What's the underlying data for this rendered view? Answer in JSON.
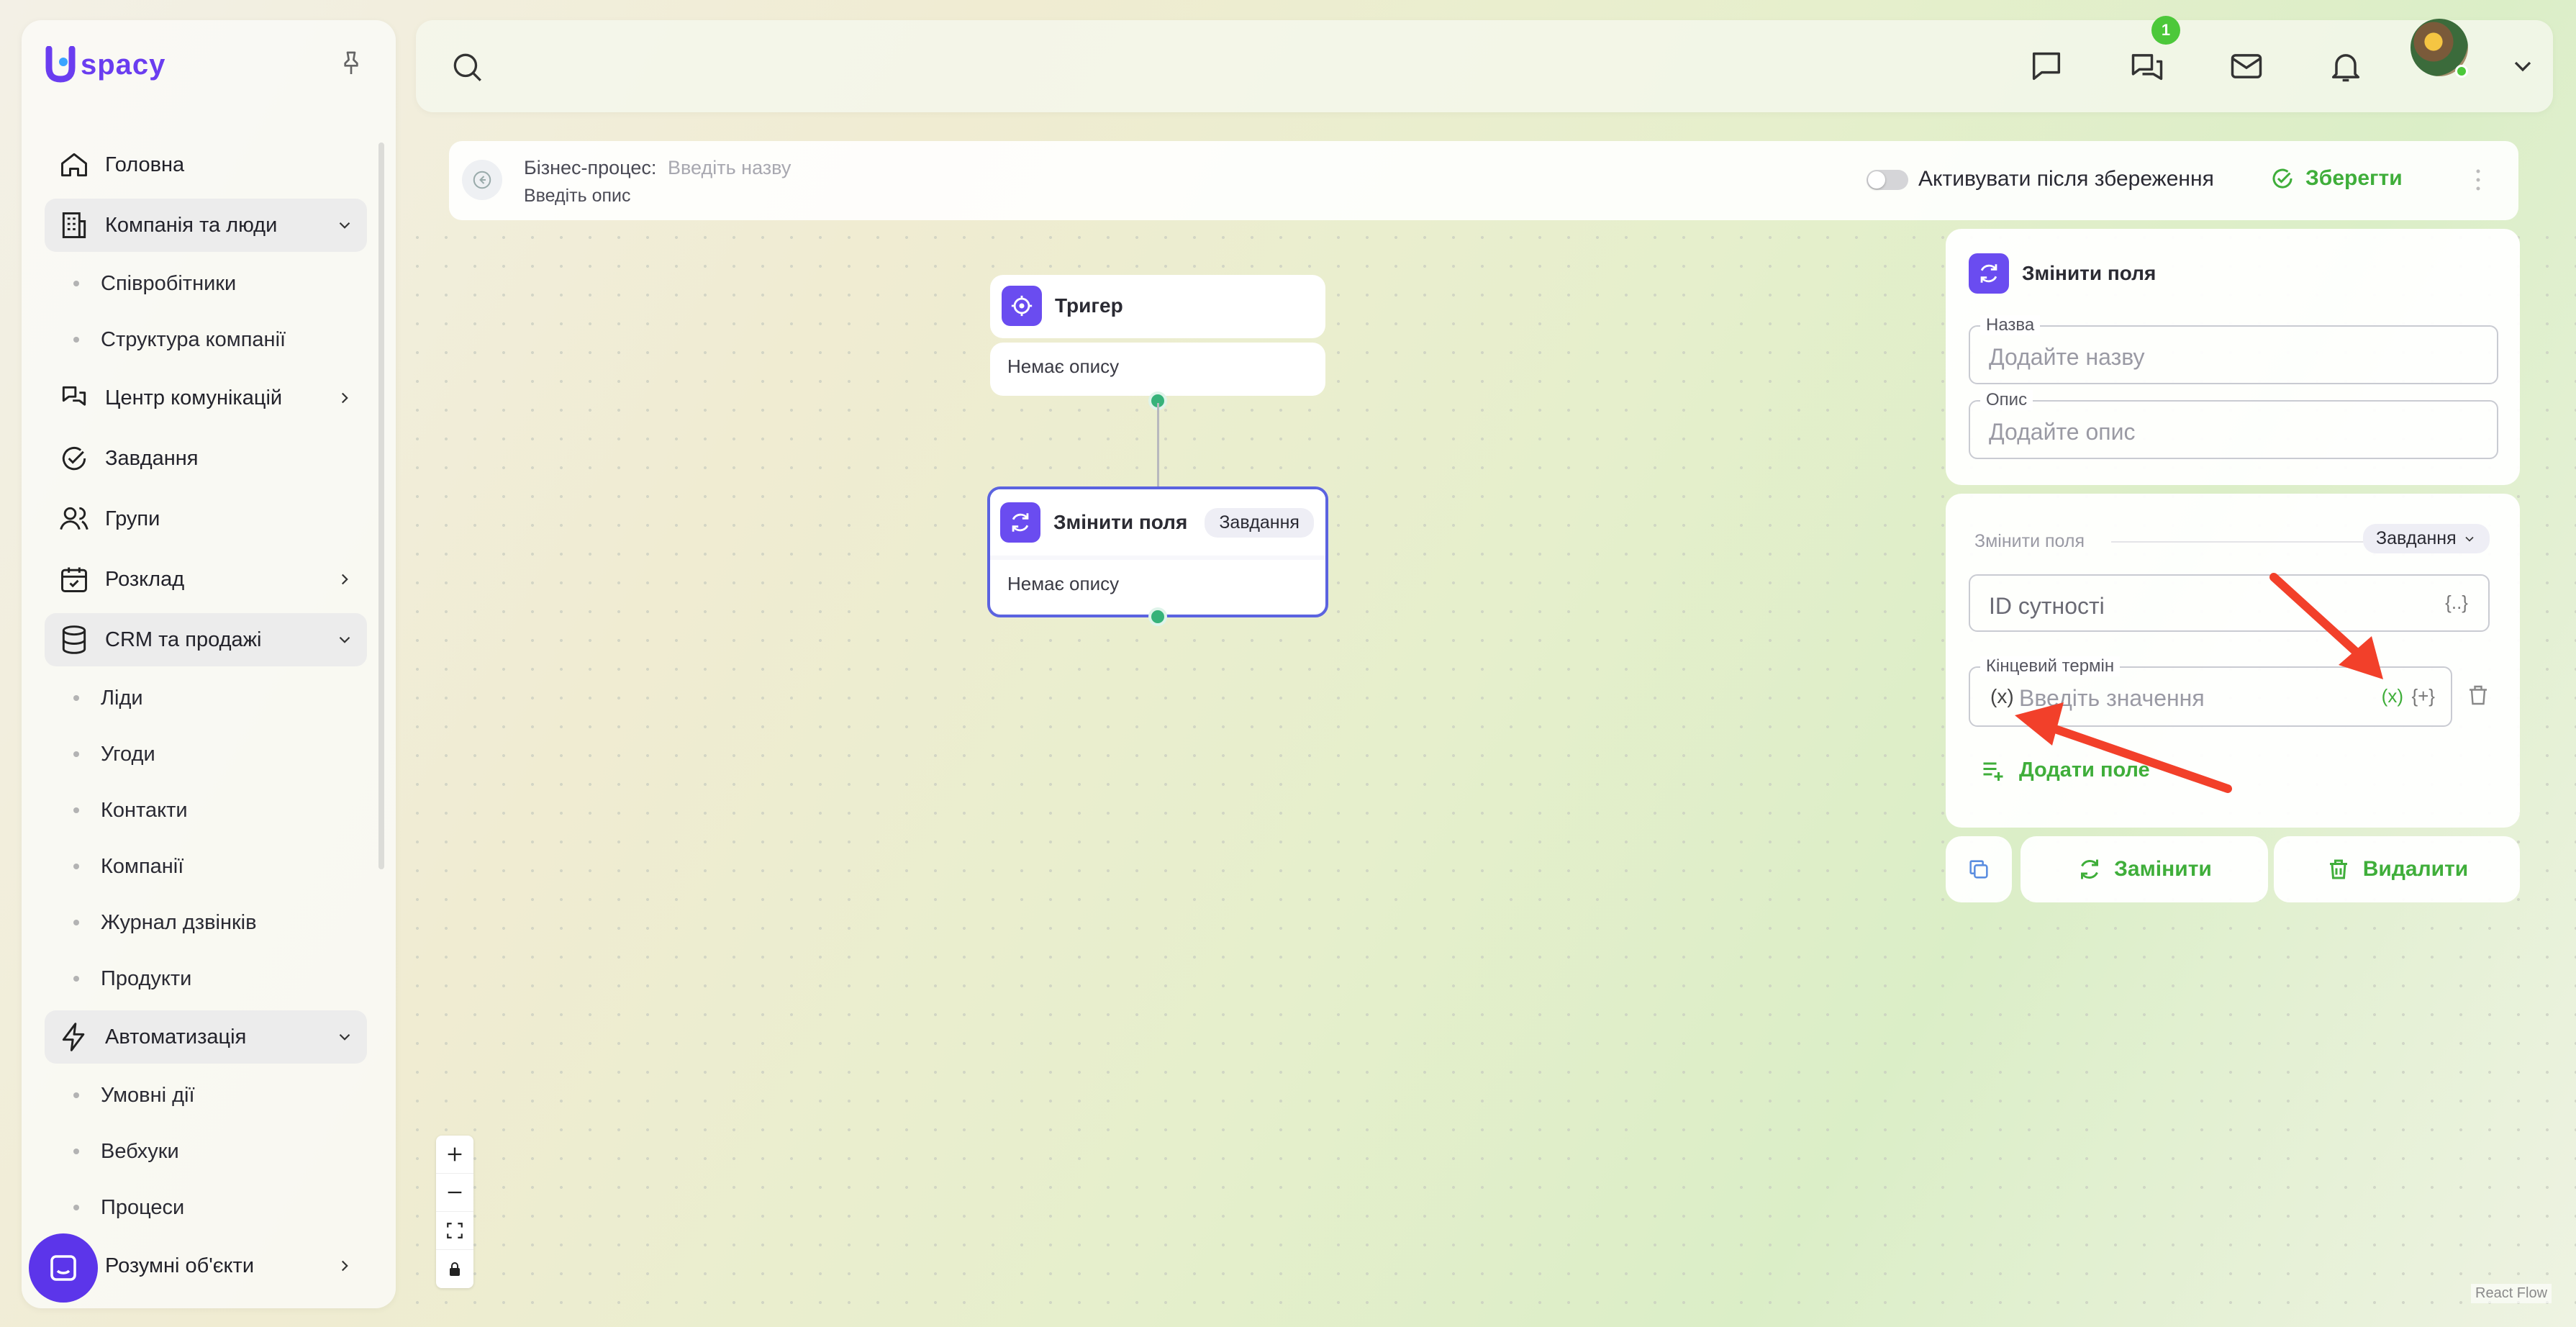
{
  "app": {
    "brand": "spacy"
  },
  "sidebar": {
    "items": [
      {
        "label": "Головна",
        "icon": "home-icon"
      },
      {
        "label": "Компанія та люди",
        "icon": "building-icon",
        "group": true
      },
      {
        "label": "Співробітники",
        "sub": true
      },
      {
        "label": "Структура компанії",
        "sub": true
      },
      {
        "label": "Центр комунікацій",
        "icon": "chat-flow-icon"
      },
      {
        "label": "Завдання",
        "icon": "check-circle-icon"
      },
      {
        "label": "Групи",
        "icon": "users-icon"
      },
      {
        "label": "Розклад",
        "icon": "calendar-icon"
      },
      {
        "label": "CRM та продажі",
        "icon": "database-icon",
        "group": true
      },
      {
        "label": "Ліди",
        "sub": true
      },
      {
        "label": "Угоди",
        "sub": true
      },
      {
        "label": "Контакти",
        "sub": true
      },
      {
        "label": "Компанії",
        "sub": true
      },
      {
        "label": "Журнал дзвінків",
        "sub": true
      },
      {
        "label": "Продукти",
        "sub": true
      },
      {
        "label": "Автоматизація",
        "icon": "lightning-icon",
        "group": true
      },
      {
        "label": "Умовні дії",
        "sub": true
      },
      {
        "label": "Вебхуки",
        "sub": true
      },
      {
        "label": "Процеси",
        "sub": true
      },
      {
        "label": "Розумні об'єкти",
        "icon": "cube-icon"
      }
    ]
  },
  "topbar": {
    "notification_count": "1"
  },
  "process": {
    "label": "Бізнес-процес:",
    "name_placeholder": "Введіть назву",
    "desc_placeholder": "Введіть опис",
    "activate_label": "Активувати після збереження",
    "save_label": "Зберегти"
  },
  "nodes": {
    "trigger": {
      "title": "Тригер",
      "desc": "Немає опису"
    },
    "change": {
      "title": "Змінити поля",
      "tag": "Завдання",
      "desc": "Немає опису"
    }
  },
  "panel": {
    "title": "Змінити поля",
    "name_label": "Назва",
    "name_placeholder": "Додайте назву",
    "desc_label": "Опис",
    "desc_placeholder": "Додайте опис",
    "section_label": "Змінити поля",
    "section_tag": "Завдання",
    "entity_placeholder": "ID сутності",
    "deadline_label": "Кінцевий термін",
    "deadline_placeholder": "Введіть значення",
    "var_left": "(x)",
    "var_right": "(x)",
    "fn_right": "{+}",
    "entity_fn": "{..}",
    "add_field": "Додати поле",
    "replace": "Замінити",
    "delete": "Видалити"
  },
  "footer": {
    "react_flow": "React Flow"
  },
  "colors": {
    "accent_green": "#3fae3a",
    "brand_purple": "#6a3df0",
    "node_purple": "#6a4cf0",
    "arrow_red": "#f2402a"
  }
}
